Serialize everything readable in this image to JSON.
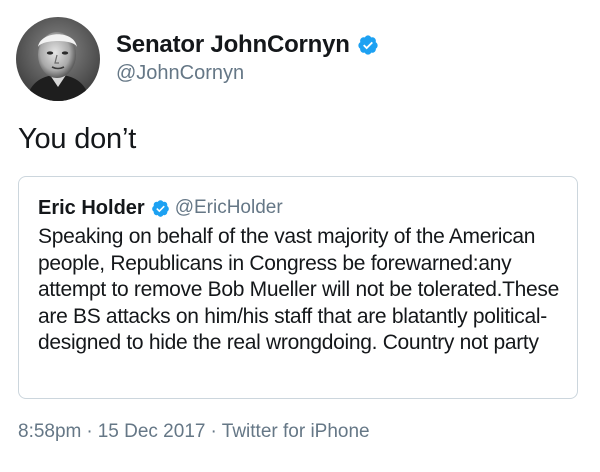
{
  "author": {
    "display_name": "Senator JohnCornyn",
    "handle": "@JohnCornyn",
    "verified": true,
    "avatar_icon": "user-avatar-photo"
  },
  "tweet": {
    "text": "You don’t"
  },
  "quoted_tweet": {
    "display_name": "Eric Holder",
    "handle": "@EricHolder",
    "verified": true,
    "text": "Speaking on behalf of the vast majority of the American people, Republicans in Congress be forewarned:any attempt to remove Bob Mueller will not be tolerated.These are BS attacks on him/his staff that are blatantly political-designed to hide the real wrongdoing. Country not party"
  },
  "meta": {
    "time": "8:58pm",
    "separator": "·",
    "date": "15 Dec 2017",
    "source": "Twitter for iPhone"
  },
  "colors": {
    "verified_badge": "#1da1f2",
    "secondary_text": "#657786",
    "border": "#ccd6dd"
  }
}
